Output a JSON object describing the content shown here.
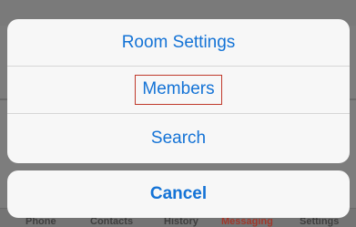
{
  "action_sheet": {
    "items": [
      {
        "label": "Room Settings"
      },
      {
        "label": "Members"
      },
      {
        "label": "Search"
      }
    ],
    "cancel_label": "Cancel",
    "accent_color": "#1473d6",
    "highlight_color": "#c0392b"
  },
  "tab_bar": {
    "tabs": [
      {
        "label": "Phone"
      },
      {
        "label": "Contacts"
      },
      {
        "label": "History"
      },
      {
        "label": "Messaging",
        "active": true
      },
      {
        "label": "Settings"
      }
    ]
  }
}
